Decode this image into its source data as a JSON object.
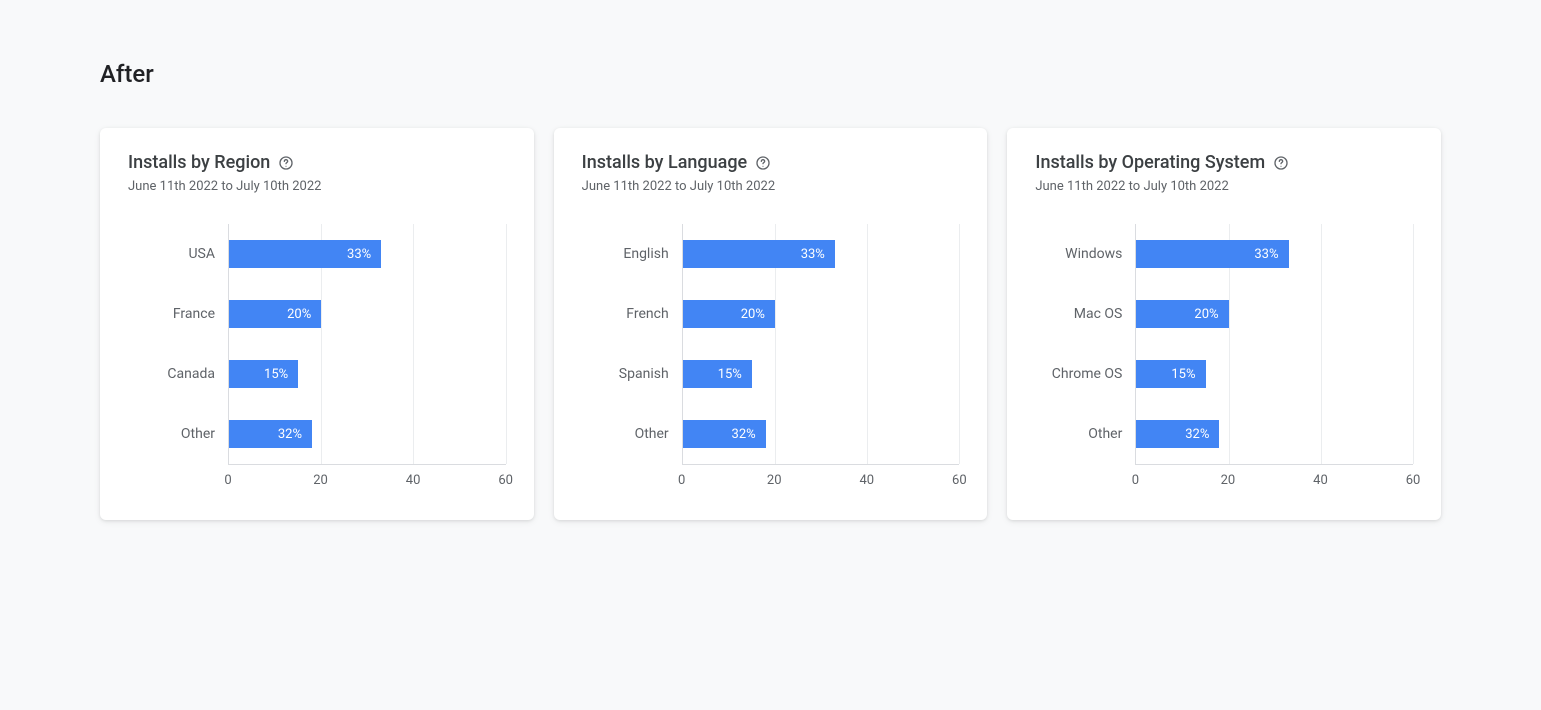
{
  "page_title": "After",
  "date_range": "June 11th 2022 to July 10th 2022",
  "axis": {
    "min": 0,
    "max": 60,
    "ticks": [
      0,
      20,
      40,
      60
    ]
  },
  "cards": [
    {
      "title": "Installs by Region",
      "series": [
        {
          "label": "USA",
          "value": 33,
          "display": "33%"
        },
        {
          "label": "France",
          "value": 20,
          "display": "20%"
        },
        {
          "label": "Canada",
          "value": 15,
          "display": "15%"
        },
        {
          "label": "Other",
          "value": 32,
          "display": "32%",
          "width_override": 18
        }
      ]
    },
    {
      "title": "Installs by Language",
      "series": [
        {
          "label": "English",
          "value": 33,
          "display": "33%"
        },
        {
          "label": "French",
          "value": 20,
          "display": "20%"
        },
        {
          "label": "Spanish",
          "value": 15,
          "display": "15%"
        },
        {
          "label": "Other",
          "value": 32,
          "display": "32%",
          "width_override": 18
        }
      ]
    },
    {
      "title": "Installs by Operating System",
      "series": [
        {
          "label": "Windows",
          "value": 33,
          "display": "33%"
        },
        {
          "label": "Mac OS",
          "value": 20,
          "display": "20%"
        },
        {
          "label": "Chrome OS",
          "value": 15,
          "display": "15%"
        },
        {
          "label": "Other",
          "value": 32,
          "display": "32%",
          "width_override": 18
        }
      ]
    }
  ],
  "chart_data": [
    {
      "type": "bar",
      "title": "Installs by Region",
      "subtitle": "June 11th 2022 to July 10th 2022",
      "orientation": "horizontal",
      "categories": [
        "USA",
        "France",
        "Canada",
        "Other"
      ],
      "values": [
        33,
        20,
        15,
        32
      ],
      "value_suffix": "%",
      "xlabel": "",
      "ylabel": "",
      "xlim": [
        0,
        60
      ],
      "xticks": [
        0,
        20,
        40,
        60
      ]
    },
    {
      "type": "bar",
      "title": "Installs by Language",
      "subtitle": "June 11th 2022 to July 10th 2022",
      "orientation": "horizontal",
      "categories": [
        "English",
        "French",
        "Spanish",
        "Other"
      ],
      "values": [
        33,
        20,
        15,
        32
      ],
      "value_suffix": "%",
      "xlabel": "",
      "ylabel": "",
      "xlim": [
        0,
        60
      ],
      "xticks": [
        0,
        20,
        40,
        60
      ]
    },
    {
      "type": "bar",
      "title": "Installs by Operating System",
      "subtitle": "June 11th 2022 to July 10th 2022",
      "orientation": "horizontal",
      "categories": [
        "Windows",
        "Mac OS",
        "Chrome OS",
        "Other"
      ],
      "values": [
        33,
        20,
        15,
        32
      ],
      "value_suffix": "%",
      "xlabel": "",
      "ylabel": "",
      "xlim": [
        0,
        60
      ],
      "xticks": [
        0,
        20,
        40,
        60
      ]
    }
  ]
}
